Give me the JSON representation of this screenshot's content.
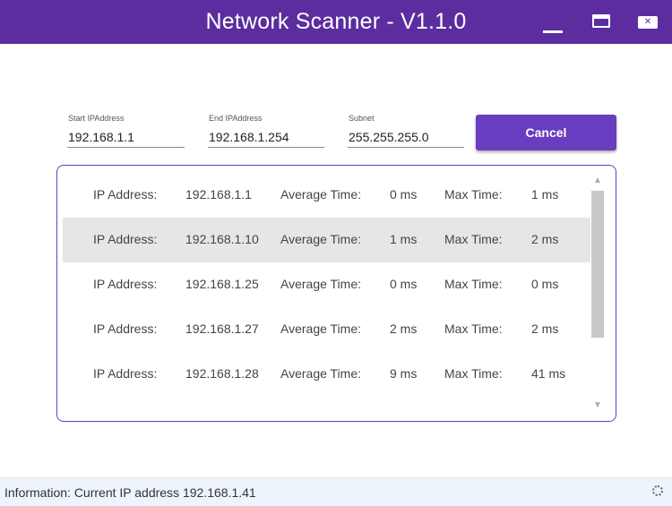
{
  "window": {
    "title": "Network Scanner - V1.1.0",
    "minimize_icon": "minimize-icon",
    "maximize_icon": "maximize-icon",
    "close_icon": "close-icon",
    "accent_color": "#5b2d9e"
  },
  "form": {
    "start_ip": {
      "label": "Start IPAddress",
      "value": "192.168.1.1"
    },
    "end_ip": {
      "label": "End IPAddress",
      "value": "192.168.1.254"
    },
    "subnet": {
      "label": "Subnet",
      "value": "255.255.255.0"
    },
    "cancel_label": "Cancel"
  },
  "results": {
    "rows": [
      {
        "ip_label": "IP Address:",
        "ip": "192.168.1.1",
        "avg_label": "Average Time:",
        "avg": "0 ms",
        "max_label": "Max Time:",
        "max": "1 ms"
      },
      {
        "ip_label": "IP Address:",
        "ip": "192.168.1.10",
        "avg_label": "Average Time:",
        "avg": "1 ms",
        "max_label": "Max Time:",
        "max": "2 ms"
      },
      {
        "ip_label": "IP Address:",
        "ip": "192.168.1.25",
        "avg_label": "Average Time:",
        "avg": "0 ms",
        "max_label": "Max Time:",
        "max": "0 ms"
      },
      {
        "ip_label": "IP Address:",
        "ip": "192.168.1.27",
        "avg_label": "Average Time:",
        "avg": "2 ms",
        "max_label": "Max Time:",
        "max": "2 ms"
      },
      {
        "ip_label": "IP Address:",
        "ip": "192.168.1.28",
        "avg_label": "Average Time:",
        "avg": "9 ms",
        "max_label": "Max Time:",
        "max": "41 ms"
      }
    ],
    "scroll_up_icon": "arrow-up-icon",
    "scroll_down_icon": "arrow-down-icon"
  },
  "status": {
    "text": "Information: Current IP address 192.168.1.41",
    "spinner_icon": "loading-spinner-icon"
  }
}
